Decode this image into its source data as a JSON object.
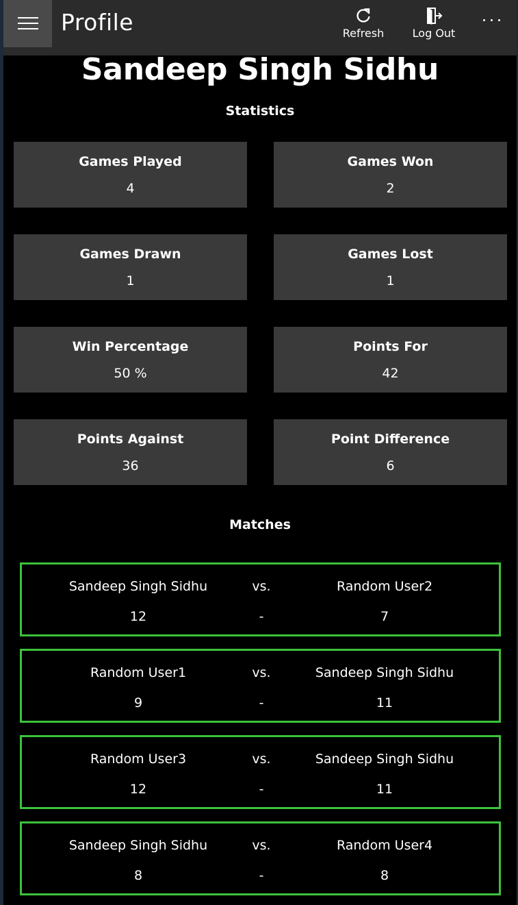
{
  "header": {
    "title": "Profile",
    "menu_icon": "hamburger-menu-icon",
    "actions": [
      {
        "label": "Refresh",
        "icon": "refresh-icon"
      },
      {
        "label": "Log Out",
        "icon": "log-out-icon"
      }
    ],
    "more_icon": "more-ellipsis-icon"
  },
  "profile": {
    "name": "Sandeep Singh Sidhu",
    "statistics_heading": "Statistics",
    "stats": [
      {
        "label": "Games Played",
        "value": "4"
      },
      {
        "label": "Games Won",
        "value": "2"
      },
      {
        "label": "Games Drawn",
        "value": "1"
      },
      {
        "label": "Games Lost",
        "value": "1"
      },
      {
        "label": "Win Percentage",
        "value": "50 %"
      },
      {
        "label": "Points For",
        "value": "42"
      },
      {
        "label": "Points Against",
        "value": "36"
      },
      {
        "label": "Point Difference",
        "value": "6"
      }
    ],
    "matches_heading": "Matches",
    "matches": [
      {
        "player1": "Sandeep Singh Sidhu",
        "vs": "vs.",
        "player2": "Random User2",
        "score1": "12",
        "dash": "-",
        "score2": "7"
      },
      {
        "player1": "Random User1",
        "vs": "vs.",
        "player2": "Sandeep Singh Sidhu",
        "score1": "9",
        "dash": "-",
        "score2": "11"
      },
      {
        "player1": "Random User3",
        "vs": "vs.",
        "player2": "Sandeep Singh Sidhu",
        "score1": "12",
        "dash": "-",
        "score2": "11"
      },
      {
        "player1": "Sandeep Singh Sidhu",
        "vs": "vs.",
        "player2": "Random User4",
        "score1": "8",
        "dash": "-",
        "score2": "8"
      }
    ]
  },
  "colors": {
    "background": "#000000",
    "titlebar": "#2b2b2b",
    "card": "#3a3a3a",
    "match_border": "#3cc23c",
    "text": "#ffffff"
  }
}
